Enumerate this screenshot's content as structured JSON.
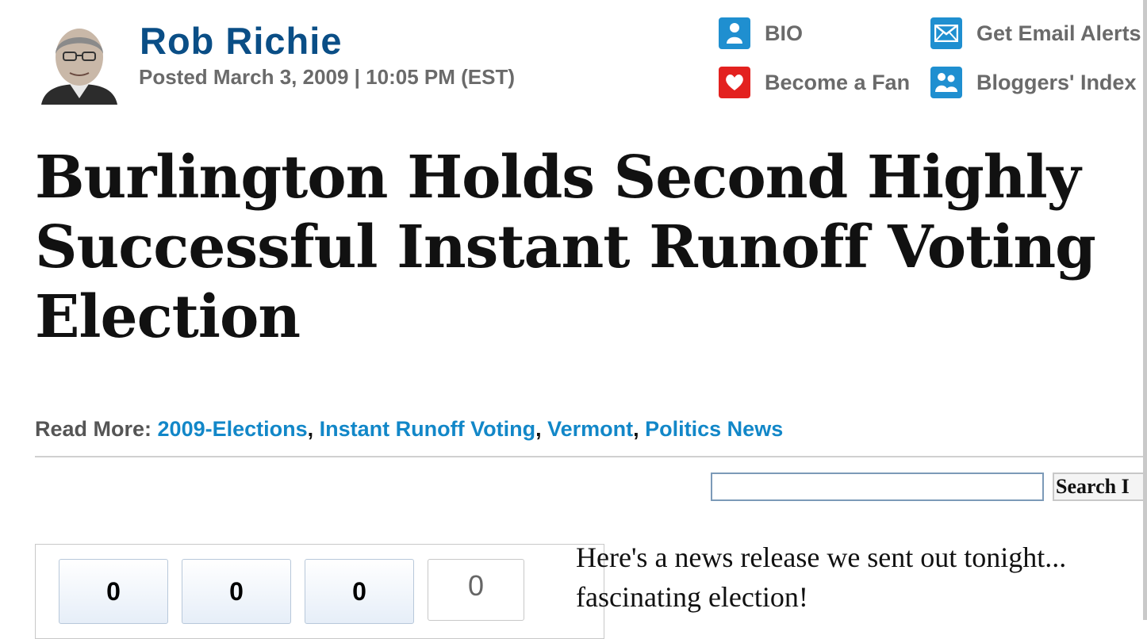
{
  "author": {
    "name": "Rob Richie",
    "posted": "Posted March 3, 2009 | 10:05 PM (EST)"
  },
  "actions": [
    {
      "label": "BIO",
      "icon": "person-icon",
      "color": "#1f8fd0"
    },
    {
      "label": "Get Email Alerts",
      "icon": "envelope-icon",
      "color": "#1f8fd0"
    },
    {
      "label": "Become a Fan",
      "icon": "heart-icon",
      "color": "#e3211f"
    },
    {
      "label": "Bloggers' Index",
      "icon": "people-icon",
      "color": "#1f8fd0"
    }
  ],
  "headline": "Burlington Holds Second Highly Successful Instant Runoff Voting Election",
  "read_more": {
    "label": "Read More: ",
    "tags": [
      "2009-Elections",
      "Instant Runoff Voting",
      "Vermont",
      "Politics News"
    ]
  },
  "search": {
    "value": "",
    "button_label": "Search I"
  },
  "share_counts": [
    "0",
    "0",
    "0",
    "0"
  ],
  "body": {
    "line1": "Here's a news release we sent out tonight... ",
    "line2": "fascinating election!"
  },
  "colors": {
    "author_name": "#0a4e86",
    "link": "#1287c8",
    "headline": "#111111"
  }
}
